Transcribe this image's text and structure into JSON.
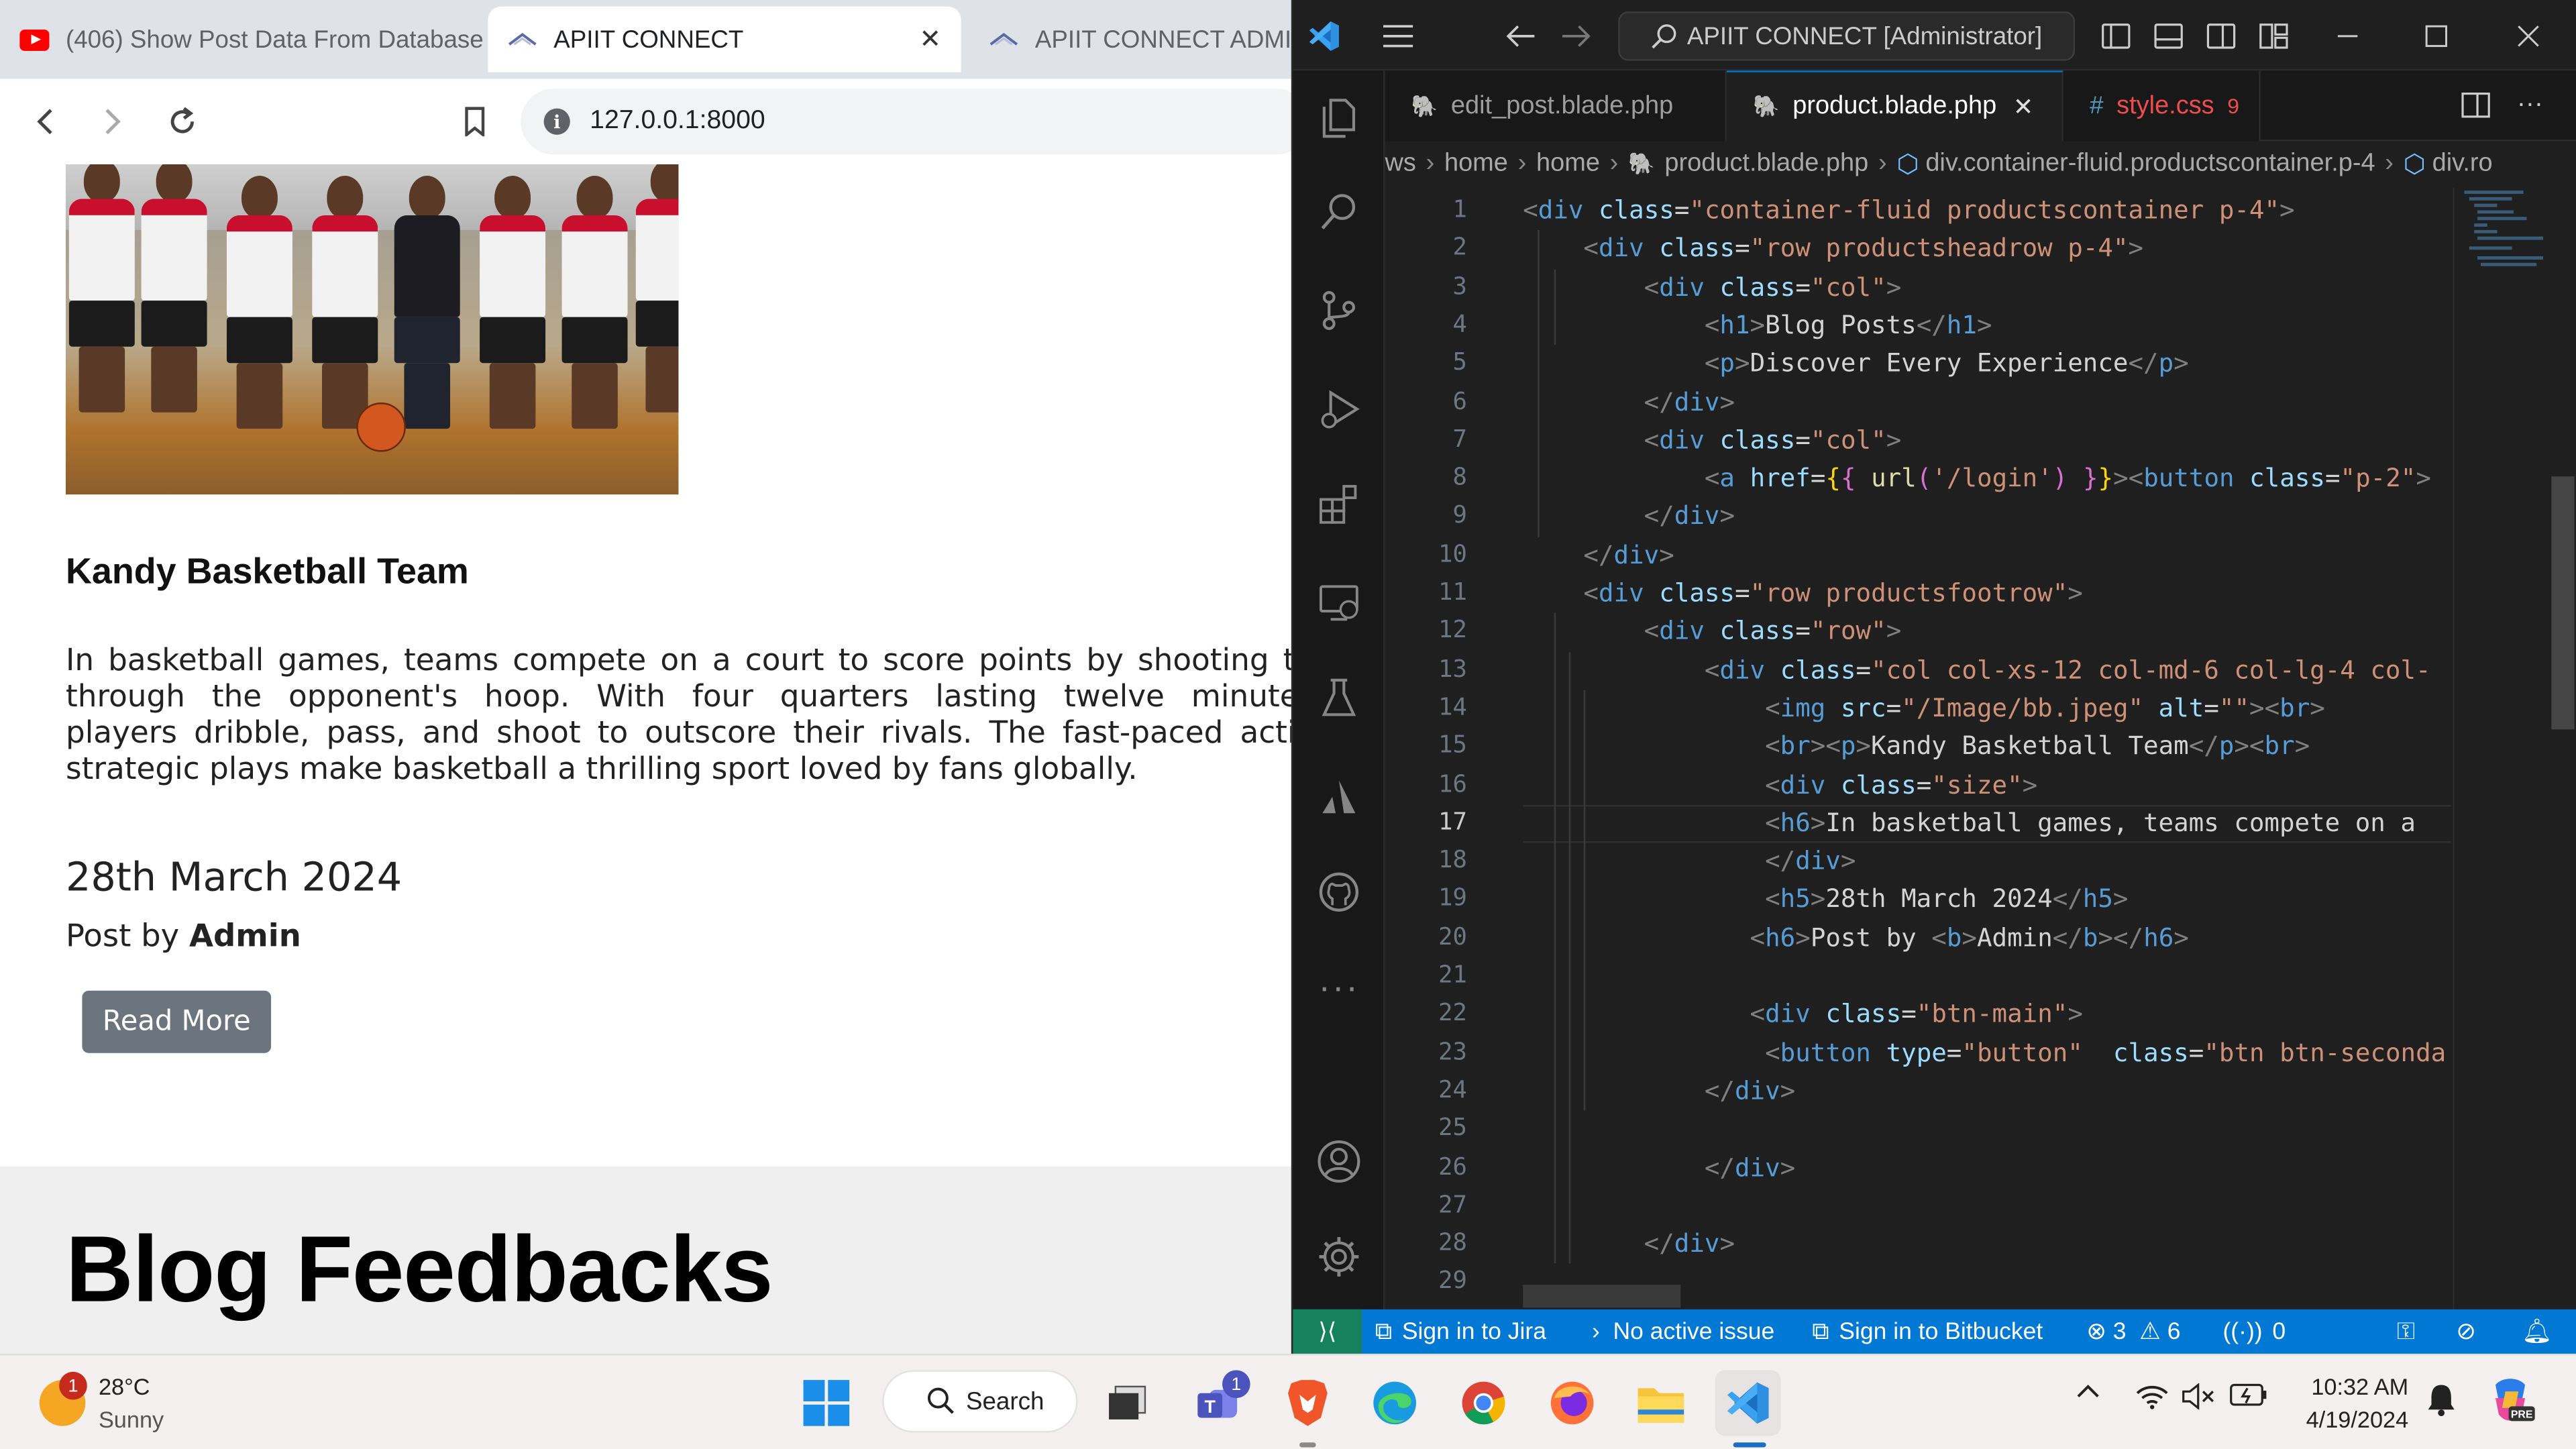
{
  "browser": {
    "tabs": [
      {
        "title": "(406) Show Post Data From Database",
        "icon": "youtube-icon",
        "active": false
      },
      {
        "title": "APIIT CONNECT",
        "icon": "apiit-favicon",
        "active": true
      },
      {
        "title": "APIIT CONNECT ADMIN",
        "icon": "apiit-favicon",
        "active": false
      }
    ],
    "url": "127.0.0.1:8000"
  },
  "blog_card": {
    "image_alt": "Kandy basketball team photo",
    "title": "Kandy Basketball Team",
    "description_lines": [
      "In basketball games, teams compete on a court to score points by shooting th",
      "through the opponent's hoop. With four quarters lasting twelve minutes",
      "players dribble, pass, and shoot to outscore their rivals. The fast-paced actio",
      "strategic plays make basketball a thrilling sport loved by fans globally."
    ],
    "date": "28th March 2024",
    "post_by_prefix": "Post by ",
    "author": "Admin",
    "read_more_label": "Read More"
  },
  "feedback_section": {
    "heading": "Blog Feedbacks"
  },
  "vscode": {
    "search_text": "APIIT CONNECT [Administrator]",
    "editor_tabs": [
      {
        "name": "edit_post.blade.php",
        "active": false
      },
      {
        "name": "product.blade.php",
        "active": true
      },
      {
        "name": "style.css",
        "active": false,
        "problems": "9"
      }
    ],
    "breadcrumbs": [
      "ws",
      "home",
      "home",
      "product.blade.php",
      "div.container-fluid.productscontainer.p-4",
      "div.ro"
    ],
    "current_line": 17,
    "line_numbers": [
      "1",
      "2",
      "3",
      "4",
      "5",
      "6",
      "7",
      "8",
      "9",
      "10",
      "11",
      "12",
      "13",
      "14",
      "15",
      "16",
      "17",
      "18",
      "19",
      "20",
      "21",
      "22",
      "23",
      "24",
      "25",
      "26",
      "27",
      "28",
      "29"
    ],
    "code_lines": [
      [
        {
          "t": "br",
          "v": "<"
        },
        {
          "t": "tag",
          "v": "div"
        },
        {
          "t": "txt",
          "v": " "
        },
        {
          "t": "attr",
          "v": "class"
        },
        {
          "t": "txt",
          "v": "="
        },
        {
          "t": "str",
          "v": "\"container-fluid productscontainer p-4\""
        },
        {
          "t": "br",
          "v": ">"
        }
      ],
      [
        {
          "t": "txt",
          "v": "    "
        },
        {
          "t": "br",
          "v": "<"
        },
        {
          "t": "tag",
          "v": "div"
        },
        {
          "t": "txt",
          "v": " "
        },
        {
          "t": "attr",
          "v": "class"
        },
        {
          "t": "txt",
          "v": "="
        },
        {
          "t": "str",
          "v": "\"row productsheadrow p-4\""
        },
        {
          "t": "br",
          "v": ">"
        }
      ],
      [
        {
          "t": "txt",
          "v": "        "
        },
        {
          "t": "br",
          "v": "<"
        },
        {
          "t": "tag",
          "v": "div"
        },
        {
          "t": "txt",
          "v": " "
        },
        {
          "t": "attr",
          "v": "class"
        },
        {
          "t": "txt",
          "v": "="
        },
        {
          "t": "str",
          "v": "\"col\""
        },
        {
          "t": "br",
          "v": ">"
        }
      ],
      [
        {
          "t": "txt",
          "v": "            "
        },
        {
          "t": "br",
          "v": "<"
        },
        {
          "t": "tag",
          "v": "h1"
        },
        {
          "t": "br",
          "v": ">"
        },
        {
          "t": "txt",
          "v": "Blog Posts"
        },
        {
          "t": "br",
          "v": "</"
        },
        {
          "t": "tag",
          "v": "h1"
        },
        {
          "t": "br",
          "v": ">"
        }
      ],
      [
        {
          "t": "txt",
          "v": "            "
        },
        {
          "t": "br",
          "v": "<"
        },
        {
          "t": "tag",
          "v": "p"
        },
        {
          "t": "br",
          "v": ">"
        },
        {
          "t": "txt",
          "v": "Discover Every Experience"
        },
        {
          "t": "br",
          "v": "</"
        },
        {
          "t": "tag",
          "v": "p"
        },
        {
          "t": "br",
          "v": ">"
        }
      ],
      [
        {
          "t": "txt",
          "v": "        "
        },
        {
          "t": "br",
          "v": "</"
        },
        {
          "t": "tag",
          "v": "div"
        },
        {
          "t": "br",
          "v": ">"
        }
      ],
      [
        {
          "t": "txt",
          "v": "        "
        },
        {
          "t": "br",
          "v": "<"
        },
        {
          "t": "tag",
          "v": "div"
        },
        {
          "t": "txt",
          "v": " "
        },
        {
          "t": "attr",
          "v": "class"
        },
        {
          "t": "txt",
          "v": "="
        },
        {
          "t": "str",
          "v": "\"col\""
        },
        {
          "t": "br",
          "v": ">"
        }
      ],
      [
        {
          "t": "txt",
          "v": "            "
        },
        {
          "t": "br",
          "v": "<"
        },
        {
          "t": "tag",
          "v": "a"
        },
        {
          "t": "txt",
          "v": " "
        },
        {
          "t": "attr",
          "v": "href"
        },
        {
          "t": "txt",
          "v": "="
        },
        {
          "t": "mus",
          "v": "{"
        },
        {
          "t": "brace",
          "v": "{ "
        },
        {
          "t": "fn",
          "v": "url"
        },
        {
          "t": "brace",
          "v": "("
        },
        {
          "t": "str",
          "v": "'/login'"
        },
        {
          "t": "brace",
          "v": ")"
        },
        {
          "t": "txt",
          "v": " "
        },
        {
          "t": "brace",
          "v": "}"
        },
        {
          "t": "mus",
          "v": "}"
        },
        {
          "t": "br",
          "v": "><"
        },
        {
          "t": "tag",
          "v": "button"
        },
        {
          "t": "txt",
          "v": " "
        },
        {
          "t": "attr",
          "v": "class"
        },
        {
          "t": "txt",
          "v": "="
        },
        {
          "t": "str",
          "v": "\"p-2\""
        },
        {
          "t": "br",
          "v": ">"
        }
      ],
      [
        {
          "t": "txt",
          "v": "        "
        },
        {
          "t": "br",
          "v": "</"
        },
        {
          "t": "tag",
          "v": "div"
        },
        {
          "t": "br",
          "v": ">"
        }
      ],
      [
        {
          "t": "txt",
          "v": "    "
        },
        {
          "t": "br",
          "v": "</"
        },
        {
          "t": "tag",
          "v": "div"
        },
        {
          "t": "br",
          "v": ">"
        }
      ],
      [
        {
          "t": "txt",
          "v": "    "
        },
        {
          "t": "br",
          "v": "<"
        },
        {
          "t": "tag",
          "v": "div"
        },
        {
          "t": "txt",
          "v": " "
        },
        {
          "t": "attr",
          "v": "class"
        },
        {
          "t": "txt",
          "v": "="
        },
        {
          "t": "str",
          "v": "\"row productsfootrow\""
        },
        {
          "t": "br",
          "v": ">"
        }
      ],
      [
        {
          "t": "txt",
          "v": "        "
        },
        {
          "t": "br",
          "v": "<"
        },
        {
          "t": "tag",
          "v": "div"
        },
        {
          "t": "txt",
          "v": " "
        },
        {
          "t": "attr",
          "v": "class"
        },
        {
          "t": "txt",
          "v": "="
        },
        {
          "t": "str",
          "v": "\"row\""
        },
        {
          "t": "br",
          "v": ">"
        }
      ],
      [
        {
          "t": "txt",
          "v": "            "
        },
        {
          "t": "br",
          "v": "<"
        },
        {
          "t": "tag",
          "v": "div"
        },
        {
          "t": "txt",
          "v": " "
        },
        {
          "t": "attr",
          "v": "class"
        },
        {
          "t": "txt",
          "v": "="
        },
        {
          "t": "str",
          "v": "\"col col-xs-12 col-md-6 col-lg-4 col-"
        }
      ],
      [
        {
          "t": "txt",
          "v": "                "
        },
        {
          "t": "br",
          "v": "<"
        },
        {
          "t": "tag",
          "v": "img"
        },
        {
          "t": "txt",
          "v": " "
        },
        {
          "t": "attr",
          "v": "src"
        },
        {
          "t": "txt",
          "v": "="
        },
        {
          "t": "str",
          "v": "\"/Image/bb.jpeg\""
        },
        {
          "t": "txt",
          "v": " "
        },
        {
          "t": "attr",
          "v": "alt"
        },
        {
          "t": "txt",
          "v": "="
        },
        {
          "t": "str",
          "v": "\"\""
        },
        {
          "t": "br",
          "v": "><"
        },
        {
          "t": "tag",
          "v": "br"
        },
        {
          "t": "br",
          "v": ">"
        }
      ],
      [
        {
          "t": "txt",
          "v": "                "
        },
        {
          "t": "br",
          "v": "<"
        },
        {
          "t": "tag",
          "v": "br"
        },
        {
          "t": "br",
          "v": "><"
        },
        {
          "t": "tag",
          "v": "p"
        },
        {
          "t": "br",
          "v": ">"
        },
        {
          "t": "txt",
          "v": "Kandy Basketball Team"
        },
        {
          "t": "br",
          "v": "</"
        },
        {
          "t": "tag",
          "v": "p"
        },
        {
          "t": "br",
          "v": "><"
        },
        {
          "t": "tag",
          "v": "br"
        },
        {
          "t": "br",
          "v": ">"
        }
      ],
      [
        {
          "t": "txt",
          "v": "                "
        },
        {
          "t": "br",
          "v": "<"
        },
        {
          "t": "tag",
          "v": "div"
        },
        {
          "t": "txt",
          "v": " "
        },
        {
          "t": "attr",
          "v": "class"
        },
        {
          "t": "txt",
          "v": "="
        },
        {
          "t": "str",
          "v": "\"size\""
        },
        {
          "t": "br",
          "v": ">"
        }
      ],
      [
        {
          "t": "txt",
          "v": "                "
        },
        {
          "t": "br",
          "v": "<"
        },
        {
          "t": "tag",
          "v": "h6"
        },
        {
          "t": "br",
          "v": ">"
        },
        {
          "t": "txt",
          "v": "In basketball games, teams compete on a"
        }
      ],
      [
        {
          "t": "txt",
          "v": "                "
        },
        {
          "t": "br",
          "v": "</"
        },
        {
          "t": "tag",
          "v": "div"
        },
        {
          "t": "br",
          "v": ">"
        }
      ],
      [
        {
          "t": "txt",
          "v": "                "
        },
        {
          "t": "br",
          "v": "<"
        },
        {
          "t": "tag",
          "v": "h5"
        },
        {
          "t": "br",
          "v": ">"
        },
        {
          "t": "txt",
          "v": "28th March 2024"
        },
        {
          "t": "br",
          "v": "</"
        },
        {
          "t": "tag",
          "v": "h5"
        },
        {
          "t": "br",
          "v": ">"
        }
      ],
      [
        {
          "t": "txt",
          "v": "               "
        },
        {
          "t": "br",
          "v": "<"
        },
        {
          "t": "tag",
          "v": "h6"
        },
        {
          "t": "br",
          "v": ">"
        },
        {
          "t": "txt",
          "v": "Post by "
        },
        {
          "t": "br",
          "v": "<"
        },
        {
          "t": "tag",
          "v": "b"
        },
        {
          "t": "br",
          "v": ">"
        },
        {
          "t": "txt",
          "v": "Admin"
        },
        {
          "t": "br",
          "v": "</"
        },
        {
          "t": "tag",
          "v": "b"
        },
        {
          "t": "br",
          "v": "></"
        },
        {
          "t": "tag",
          "v": "h6"
        },
        {
          "t": "br",
          "v": ">"
        }
      ],
      [],
      [
        {
          "t": "txt",
          "v": "               "
        },
        {
          "t": "br",
          "v": "<"
        },
        {
          "t": "tag",
          "v": "div"
        },
        {
          "t": "txt",
          "v": " "
        },
        {
          "t": "attr",
          "v": "class"
        },
        {
          "t": "txt",
          "v": "="
        },
        {
          "t": "str",
          "v": "\"btn-main\""
        },
        {
          "t": "br",
          "v": ">"
        }
      ],
      [
        {
          "t": "txt",
          "v": "                "
        },
        {
          "t": "br",
          "v": "<"
        },
        {
          "t": "tag",
          "v": "button"
        },
        {
          "t": "txt",
          "v": " "
        },
        {
          "t": "attr",
          "v": "type"
        },
        {
          "t": "txt",
          "v": "="
        },
        {
          "t": "str",
          "v": "\"button\""
        },
        {
          "t": "txt",
          "v": "  "
        },
        {
          "t": "attr",
          "v": "class"
        },
        {
          "t": "txt",
          "v": "="
        },
        {
          "t": "str",
          "v": "\"btn btn-seconda"
        }
      ],
      [
        {
          "t": "txt",
          "v": "            "
        },
        {
          "t": "br",
          "v": "</"
        },
        {
          "t": "tag",
          "v": "div"
        },
        {
          "t": "br",
          "v": ">"
        }
      ],
      [],
      [
        {
          "t": "txt",
          "v": "            "
        },
        {
          "t": "br",
          "v": "</"
        },
        {
          "t": "tag",
          "v": "div"
        },
        {
          "t": "br",
          "v": ">"
        }
      ],
      [],
      [
        {
          "t": "txt",
          "v": "        "
        },
        {
          "t": "br",
          "v": "</"
        },
        {
          "t": "tag",
          "v": "div"
        },
        {
          "t": "br",
          "v": ">"
        }
      ],
      []
    ],
    "status_bar": {
      "jira": "Sign in to Jira",
      "issue": "No active issue",
      "bitbucket": "Sign in to Bitbucket",
      "errors": "3",
      "warnings": "6",
      "ports": "0"
    }
  },
  "taskbar": {
    "weather_temp": "28°C",
    "weather_desc": "Sunny",
    "weather_badge": "1",
    "search_label": "Search",
    "teams_badge": "1",
    "time": "10:32 AM",
    "date": "4/19/2024"
  },
  "colors": {
    "accent_blue": "#0078d4",
    "read_more_bg": "#6c757d",
    "vscode_bg": "#1f1f1f",
    "taskbar_bg": "#f3f0ef"
  }
}
